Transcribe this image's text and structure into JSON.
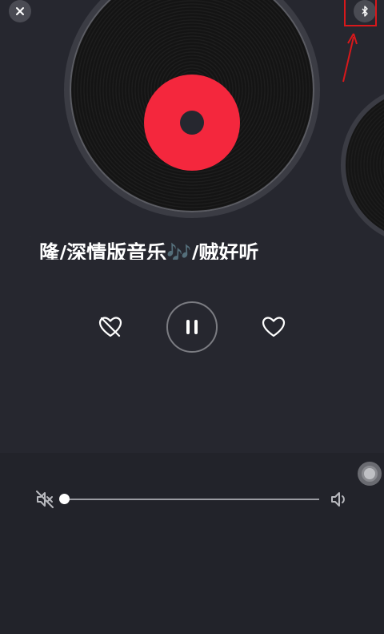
{
  "song": {
    "title": "隆/深情版音乐🎶/贼好听",
    "title_prefix_fragment": "阝"
  },
  "icons": {
    "close": "close-icon",
    "bluetooth": "bluetooth-icon",
    "dislike": "heart-off-icon",
    "pause": "pause-icon",
    "like": "heart-icon",
    "volume_mute": "volume-mute-icon",
    "volume_up": "volume-up-icon"
  },
  "playback": {
    "state": "playing",
    "volume_level": 0
  },
  "colors": {
    "background": "#26272f",
    "record_label": "#f4273d",
    "annotation": "#d8181b"
  }
}
